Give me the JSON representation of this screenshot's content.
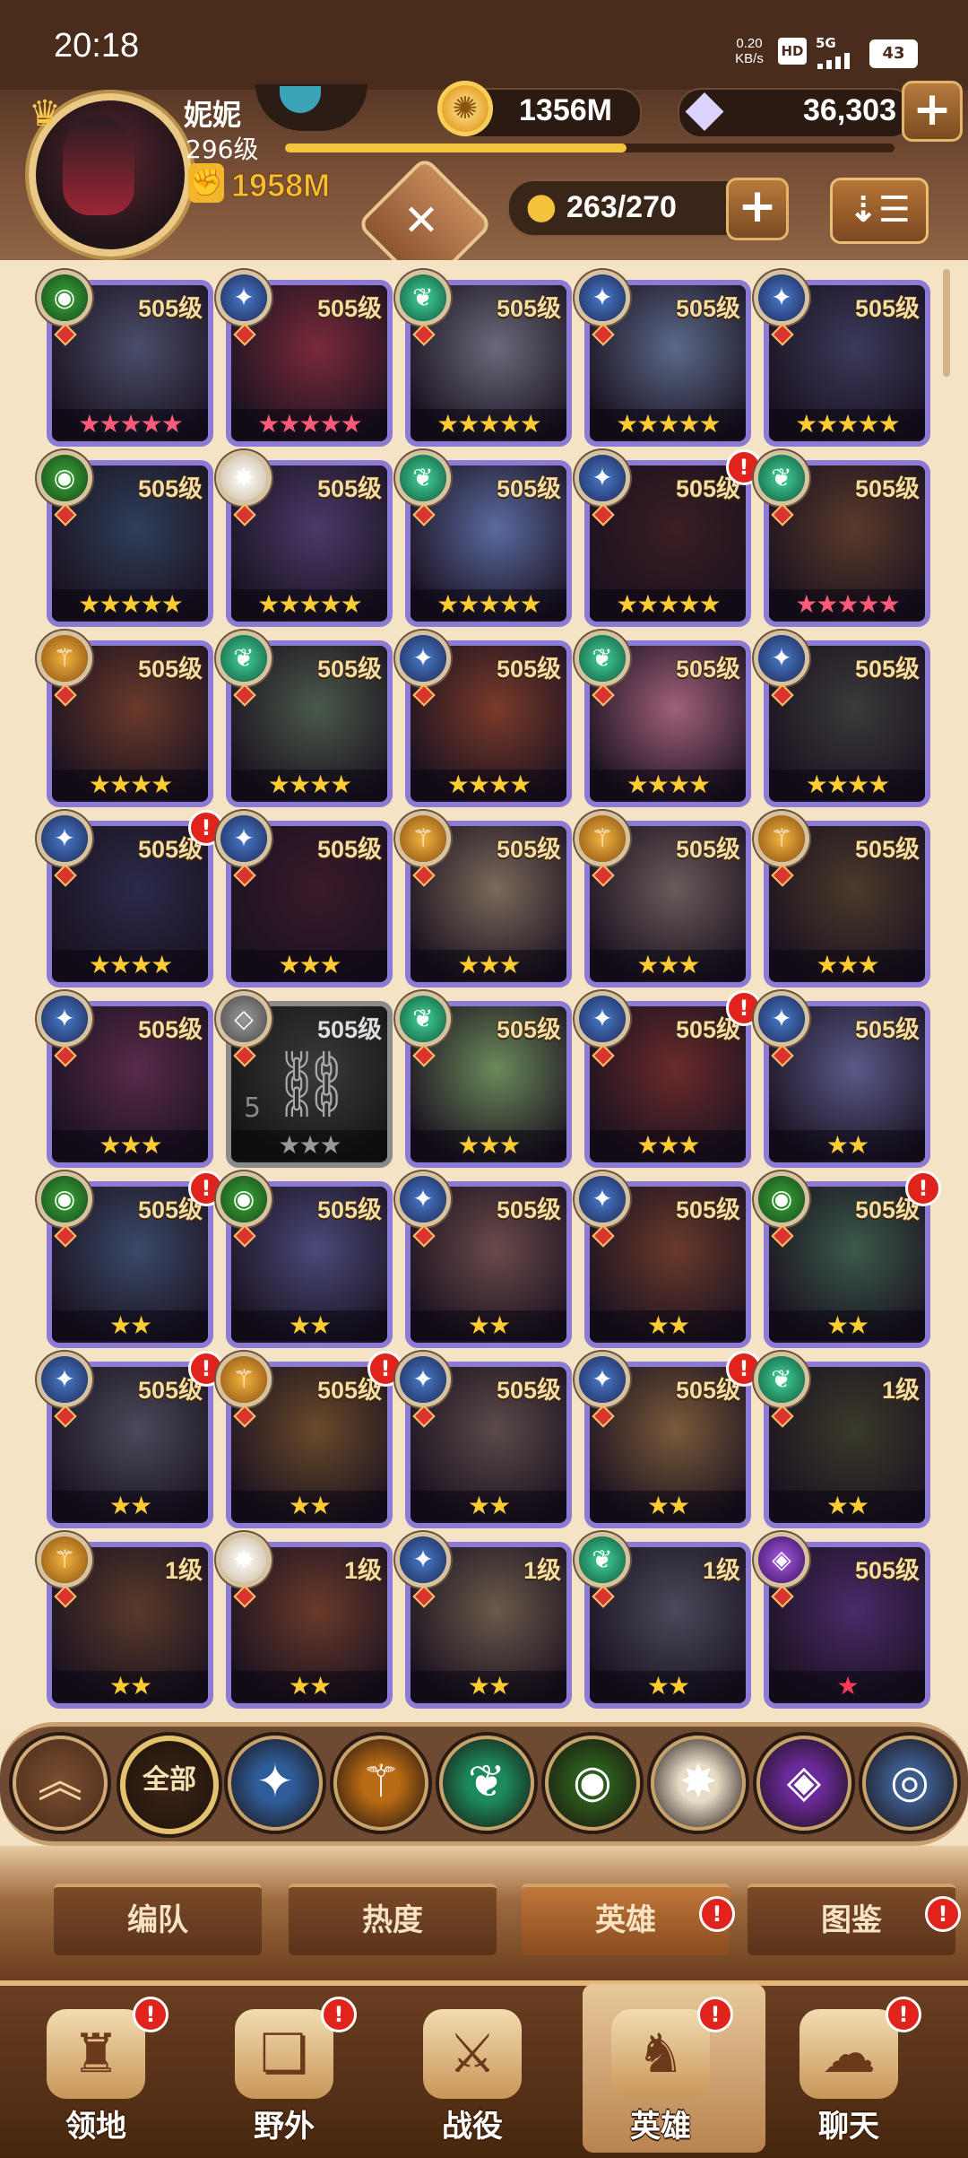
{
  "status": {
    "time": "20:18",
    "net_speed": "0.20\nKB/s",
    "hd": "HD",
    "net_type": "5G",
    "battery": "43"
  },
  "player": {
    "name": "妮妮",
    "level": "296级",
    "xp_progress": 0.56,
    "power": "1958M"
  },
  "currency": {
    "gold": "1356M",
    "gems": "36,303"
  },
  "roster": {
    "count": "263/270"
  },
  "icons": {
    "plus": "+",
    "gold": "coin-icon",
    "gem": "diamond-icon",
    "power": "fist-icon",
    "roster": "person-icon",
    "sort": "sort-icon",
    "emblem": "guild-emblem-icon"
  },
  "heroes": [
    {
      "level": "505级",
      "stars": "★★★★★",
      "star_color": "#ff5a7a",
      "faction": "green",
      "alert": false,
      "tint": "#4a4e6a"
    },
    {
      "level": "505级",
      "stars": "★★★★★",
      "star_color": "#ff5a7a",
      "faction": "blue",
      "alert": false,
      "tint": "#7a2a3a"
    },
    {
      "level": "505级",
      "stars": "★★★★★",
      "star_color": "#ffcc33",
      "faction": "teal",
      "alert": false,
      "tint": "#6a6a7a"
    },
    {
      "level": "505级",
      "stars": "★★★★★",
      "star_color": "#ffcc33",
      "faction": "blue",
      "alert": false,
      "tint": "#5a6a8a"
    },
    {
      "level": "505级",
      "stars": "★★★★★",
      "star_color": "#ffcc33",
      "faction": "blue",
      "alert": false,
      "tint": "#3a3a5a"
    },
    {
      "level": "505级",
      "stars": "★★★★★",
      "star_color": "#ffcc33",
      "faction": "green",
      "alert": false,
      "tint": "#2e3f5a"
    },
    {
      "level": "505级",
      "stars": "★★★★★",
      "star_color": "#ffcc33",
      "faction": "white",
      "alert": false,
      "tint": "#4a3a6a"
    },
    {
      "level": "505级",
      "stars": "★★★★★",
      "star_color": "#ffcc33",
      "faction": "teal",
      "alert": false,
      "tint": "#5a6aa0"
    },
    {
      "level": "505级",
      "stars": "★★★★★",
      "star_color": "#ffcc33",
      "faction": "blue",
      "alert": true,
      "tint": "#3a1e22"
    },
    {
      "level": "505级",
      "stars": "★★★★★",
      "star_color": "#ff5a7a",
      "faction": "teal",
      "alert": false,
      "tint": "#5a3a2a"
    },
    {
      "level": "505级",
      "stars": "★★★★",
      "star_color": "#ffcc33",
      "faction": "gold",
      "alert": false,
      "tint": "#6a3a2a"
    },
    {
      "level": "505级",
      "stars": "★★★★",
      "star_color": "#ffcc33",
      "faction": "teal",
      "alert": false,
      "tint": "#4a5a4a"
    },
    {
      "level": "505级",
      "stars": "★★★★",
      "star_color": "#ffcc33",
      "faction": "blue",
      "alert": false,
      "tint": "#7a3a2a"
    },
    {
      "level": "505级",
      "stars": "★★★★",
      "star_color": "#ffcc33",
      "faction": "teal",
      "alert": false,
      "tint": "#a0607a"
    },
    {
      "level": "505级",
      "stars": "★★★★",
      "star_color": "#ffcc33",
      "faction": "blue",
      "alert": false,
      "tint": "#3a3a3a"
    },
    {
      "level": "505级",
      "stars": "★★★★",
      "star_color": "#ffcc33",
      "faction": "blue",
      "alert": true,
      "tint": "#2a2a4a"
    },
    {
      "level": "505级",
      "stars": "★★★",
      "star_color": "#ffcc33",
      "faction": "blue",
      "alert": false,
      "tint": "#3a1a2a"
    },
    {
      "level": "505级",
      "stars": "★★★",
      "star_color": "#ffcc33",
      "faction": "gold",
      "alert": false,
      "tint": "#7a6a5a"
    },
    {
      "level": "505级",
      "stars": "★★★",
      "star_color": "#ffcc33",
      "faction": "gold",
      "alert": false,
      "tint": "#6a5a5a"
    },
    {
      "level": "505级",
      "stars": "★★★",
      "star_color": "#ffcc33",
      "faction": "gold",
      "alert": false,
      "tint": "#4a3a2a"
    },
    {
      "level": "505级",
      "stars": "★★★",
      "star_color": "#ffcc33",
      "faction": "blue",
      "alert": false,
      "tint": "#5a2a4a"
    },
    {
      "level": "505级",
      "stars": "★★★",
      "star_color": "#9a9a9a",
      "faction": "grey",
      "alert": false,
      "tint": "#3a3a3a",
      "locked": true,
      "lock_num": "5"
    },
    {
      "level": "505级",
      "stars": "★★★",
      "star_color": "#ffcc33",
      "faction": "teal",
      "alert": false,
      "tint": "#6a8a5a"
    },
    {
      "level": "505级",
      "stars": "★★★",
      "star_color": "#ffcc33",
      "faction": "blue",
      "alert": true,
      "tint": "#6a2a2a"
    },
    {
      "level": "505级",
      "stars": "★★",
      "star_color": "#ffcc33",
      "faction": "blue",
      "alert": false,
      "tint": "#5a5a8a"
    },
    {
      "level": "505级",
      "stars": "★★",
      "star_color": "#ffcc33",
      "faction": "green",
      "alert": true,
      "tint": "#3a4a6a"
    },
    {
      "level": "505级",
      "stars": "★★",
      "star_color": "#ffcc33",
      "faction": "green",
      "alert": false,
      "tint": "#4a4a7a"
    },
    {
      "level": "505级",
      "stars": "★★",
      "star_color": "#ffcc33",
      "faction": "blue",
      "alert": false,
      "tint": "#6a4a4a"
    },
    {
      "level": "505级",
      "stars": "★★",
      "star_color": "#ffcc33",
      "faction": "blue",
      "alert": false,
      "tint": "#6a3a2a"
    },
    {
      "level": "505级",
      "stars": "★★",
      "star_color": "#ffcc33",
      "faction": "green",
      "alert": true,
      "tint": "#3a5a4a"
    },
    {
      "level": "505级",
      "stars": "★★",
      "star_color": "#ffcc33",
      "faction": "blue",
      "alert": true,
      "tint": "#4a4a5a"
    },
    {
      "level": "505级",
      "stars": "★★",
      "star_color": "#ffcc33",
      "faction": "gold",
      "alert": true,
      "tint": "#6a4a2a"
    },
    {
      "level": "505级",
      "stars": "★★",
      "star_color": "#ffcc33",
      "faction": "blue",
      "alert": false,
      "tint": "#5a4a4a"
    },
    {
      "level": "505级",
      "stars": "★★",
      "star_color": "#ffcc33",
      "faction": "blue",
      "alert": true,
      "tint": "#7a5a3a"
    },
    {
      "level": "1级",
      "stars": "★★",
      "star_color": "#ffcc33",
      "faction": "teal",
      "alert": false,
      "tint": "#3a3a2a"
    },
    {
      "level": "1级",
      "stars": "★★",
      "star_color": "#ffcc33",
      "faction": "gold",
      "alert": false,
      "tint": "#5a3a2a"
    },
    {
      "level": "1级",
      "stars": "★★",
      "star_color": "#ffcc33",
      "faction": "white",
      "alert": false,
      "tint": "#6a3a2a"
    },
    {
      "level": "1级",
      "stars": "★★",
      "star_color": "#ffcc33",
      "faction": "blue",
      "alert": false,
      "tint": "#6a5a4a"
    },
    {
      "level": "1级",
      "stars": "★★",
      "star_color": "#ffcc33",
      "faction": "teal",
      "alert": false,
      "tint": "#4a4a5a"
    },
    {
      "level": "505级",
      "stars": "★",
      "star_color": "#ff3a5a",
      "faction": "purple",
      "alert": false,
      "tint": "#4a2a6a"
    }
  ],
  "filters": [
    {
      "name": "collapse",
      "label": "︽"
    },
    {
      "name": "all",
      "label": "全部"
    },
    {
      "name": "lightbearer",
      "color": "#2f5d9a",
      "glyph": "✦"
    },
    {
      "name": "mauler",
      "color": "#b86a14",
      "glyph": "⚚"
    },
    {
      "name": "wilder",
      "color": "#1c8a5a",
      "glyph": "❦"
    },
    {
      "name": "graveborn",
      "color": "#2b5a1c",
      "glyph": "◉"
    },
    {
      "name": "celestial",
      "color": "#e8dcc6",
      "glyph": "✸"
    },
    {
      "name": "hypogean",
      "color": "#6a2a9a",
      "glyph": "◈"
    },
    {
      "name": "dimensional",
      "color": "#3c5a8a",
      "glyph": "◎"
    }
  ],
  "tabs": [
    "编队",
    "热度",
    "英雄",
    "图鉴"
  ],
  "tab_alerts": [
    false,
    false,
    true,
    true
  ],
  "nav": [
    {
      "label": "领地",
      "icon": "castle-icon",
      "alert": true
    },
    {
      "label": "野外",
      "icon": "map-scroll-icon",
      "alert": true
    },
    {
      "label": "战役",
      "icon": "battle-sword-icon",
      "alert": false
    },
    {
      "label": "英雄",
      "icon": "hero-helmet-icon",
      "alert": true
    },
    {
      "label": "聊天",
      "icon": "chat-bubble-icon",
      "alert": true
    }
  ],
  "alert_mark": "!"
}
